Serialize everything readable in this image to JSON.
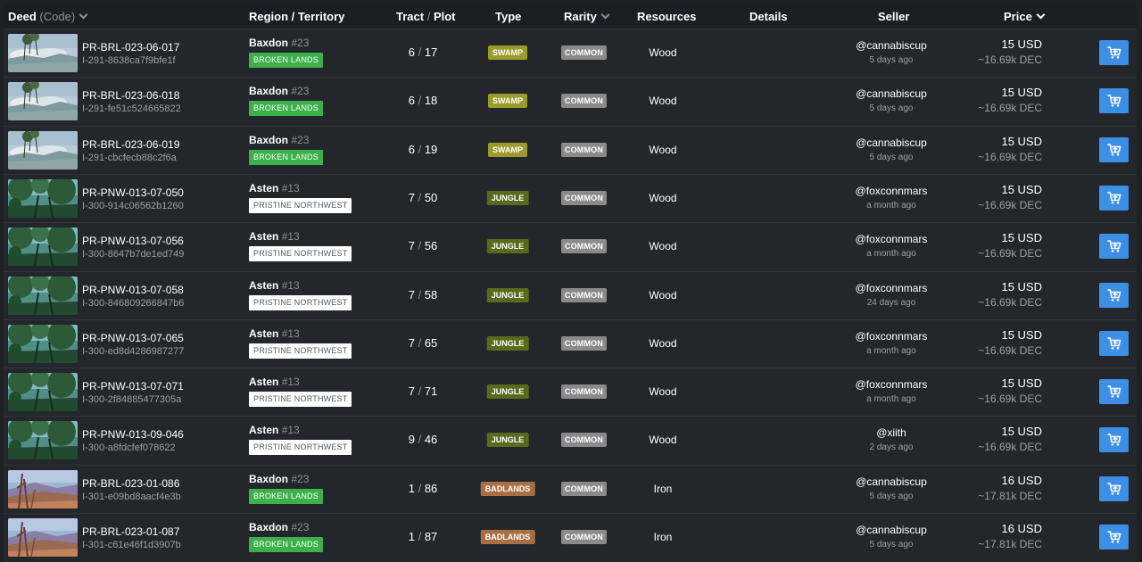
{
  "headers": {
    "deed": "Deed",
    "deed_sub": "(Code)",
    "region": "Region / Territory",
    "tract": "Tract",
    "tract_sep": "/",
    "plot": "Plot",
    "type": "Type",
    "rarity": "Rarity",
    "resources": "Resources",
    "details": "Details",
    "seller": "Seller",
    "price": "Price"
  },
  "colors": {
    "swamp": "#9b9a2a",
    "jungle": "#5a6a1c",
    "badlands": "#a86f45",
    "broken_lands": "#3cb04a",
    "pristine_northwest": "#ffffff",
    "common": "#8a8a8a",
    "buy_button": "#3d8fe6"
  },
  "rows": [
    {
      "thumb": "swamp",
      "code": "PR-BRL-023-06-017",
      "uid": "I-291-8638ca7f9bfe1f",
      "region": "Baxdon",
      "region_num": "#23",
      "territory": "BROKEN LANDS",
      "terr_class": "broken",
      "tract": "6",
      "plot": "17",
      "type": "SWAMP",
      "type_class": "swamp",
      "rarity": "COMMON",
      "resource": "Wood",
      "seller": "@cannabiscup",
      "ago": "5 days ago",
      "price": "15 USD",
      "dec": "~16.69k DEC"
    },
    {
      "thumb": "swamp",
      "code": "PR-BRL-023-06-018",
      "uid": "I-291-fe51c524665822",
      "region": "Baxdon",
      "region_num": "#23",
      "territory": "BROKEN LANDS",
      "terr_class": "broken",
      "tract": "6",
      "plot": "18",
      "type": "SWAMP",
      "type_class": "swamp",
      "rarity": "COMMON",
      "resource": "Wood",
      "seller": "@cannabiscup",
      "ago": "5 days ago",
      "price": "15 USD",
      "dec": "~16.69k DEC"
    },
    {
      "thumb": "swamp",
      "code": "PR-BRL-023-06-019",
      "uid": "I-291-cbcfecb88c2f6a",
      "region": "Baxdon",
      "region_num": "#23",
      "territory": "BROKEN LANDS",
      "terr_class": "broken",
      "tract": "6",
      "plot": "19",
      "type": "SWAMP",
      "type_class": "swamp",
      "rarity": "COMMON",
      "resource": "Wood",
      "seller": "@cannabiscup",
      "ago": "5 days ago",
      "price": "15 USD",
      "dec": "~16.69k DEC"
    },
    {
      "thumb": "jungle",
      "code": "PR-PNW-013-07-050",
      "uid": "I-300-914c06562b1260",
      "region": "Asten",
      "region_num": "#13",
      "territory": "PRISTINE NORTHWEST",
      "terr_class": "pristine",
      "tract": "7",
      "plot": "50",
      "type": "JUNGLE",
      "type_class": "jungle",
      "rarity": "COMMON",
      "resource": "Wood",
      "seller": "@foxconnmars",
      "ago": "a month ago",
      "price": "15 USD",
      "dec": "~16.69k DEC"
    },
    {
      "thumb": "jungle",
      "code": "PR-PNW-013-07-056",
      "uid": "I-300-8647b7de1ed749",
      "region": "Asten",
      "region_num": "#13",
      "territory": "PRISTINE NORTHWEST",
      "terr_class": "pristine",
      "tract": "7",
      "plot": "56",
      "type": "JUNGLE",
      "type_class": "jungle",
      "rarity": "COMMON",
      "resource": "Wood",
      "seller": "@foxconnmars",
      "ago": "a month ago",
      "price": "15 USD",
      "dec": "~16.69k DEC"
    },
    {
      "thumb": "jungle",
      "code": "PR-PNW-013-07-058",
      "uid": "I-300-846809266847b6",
      "region": "Asten",
      "region_num": "#13",
      "territory": "PRISTINE NORTHWEST",
      "terr_class": "pristine",
      "tract": "7",
      "plot": "58",
      "type": "JUNGLE",
      "type_class": "jungle",
      "rarity": "COMMON",
      "resource": "Wood",
      "seller": "@foxconnmars",
      "ago": "24 days ago",
      "price": "15 USD",
      "dec": "~16.69k DEC"
    },
    {
      "thumb": "jungle",
      "code": "PR-PNW-013-07-065",
      "uid": "I-300-ed8d4286987277",
      "region": "Asten",
      "region_num": "#13",
      "territory": "PRISTINE NORTHWEST",
      "terr_class": "pristine",
      "tract": "7",
      "plot": "65",
      "type": "JUNGLE",
      "type_class": "jungle",
      "rarity": "COMMON",
      "resource": "Wood",
      "seller": "@foxconnmars",
      "ago": "a month ago",
      "price": "15 USD",
      "dec": "~16.69k DEC"
    },
    {
      "thumb": "jungle",
      "code": "PR-PNW-013-07-071",
      "uid": "I-300-2f84885477305a",
      "region": "Asten",
      "region_num": "#13",
      "territory": "PRISTINE NORTHWEST",
      "terr_class": "pristine",
      "tract": "7",
      "plot": "71",
      "type": "JUNGLE",
      "type_class": "jungle",
      "rarity": "COMMON",
      "resource": "Wood",
      "seller": "@foxconnmars",
      "ago": "a month ago",
      "price": "15 USD",
      "dec": "~16.69k DEC"
    },
    {
      "thumb": "jungle",
      "code": "PR-PNW-013-09-046",
      "uid": "I-300-a8fdcfef078622",
      "region": "Asten",
      "region_num": "#13",
      "territory": "PRISTINE NORTHWEST",
      "terr_class": "pristine",
      "tract": "9",
      "plot": "46",
      "type": "JUNGLE",
      "type_class": "jungle",
      "rarity": "COMMON",
      "resource": "Wood",
      "seller": "@xiith",
      "ago": "2 days ago",
      "price": "15 USD",
      "dec": "~16.69k DEC"
    },
    {
      "thumb": "badlands",
      "code": "PR-BRL-023-01-086",
      "uid": "I-301-e09bd8aacf4e3b",
      "region": "Baxdon",
      "region_num": "#23",
      "territory": "BROKEN LANDS",
      "terr_class": "broken",
      "tract": "1",
      "plot": "86",
      "type": "BADLANDS",
      "type_class": "badlands",
      "rarity": "COMMON",
      "resource": "Iron",
      "seller": "@cannabiscup",
      "ago": "5 days ago",
      "price": "16 USD",
      "dec": "~17.81k DEC"
    },
    {
      "thumb": "badlands",
      "code": "PR-BRL-023-01-087",
      "uid": "I-301-c61e46f1d3907b",
      "region": "Baxdon",
      "region_num": "#23",
      "territory": "BROKEN LANDS",
      "terr_class": "broken",
      "tract": "1",
      "plot": "87",
      "type": "BADLANDS",
      "type_class": "badlands",
      "rarity": "COMMON",
      "resource": "Iron",
      "seller": "@cannabiscup",
      "ago": "5 days ago",
      "price": "16 USD",
      "dec": "~17.81k DEC"
    }
  ]
}
